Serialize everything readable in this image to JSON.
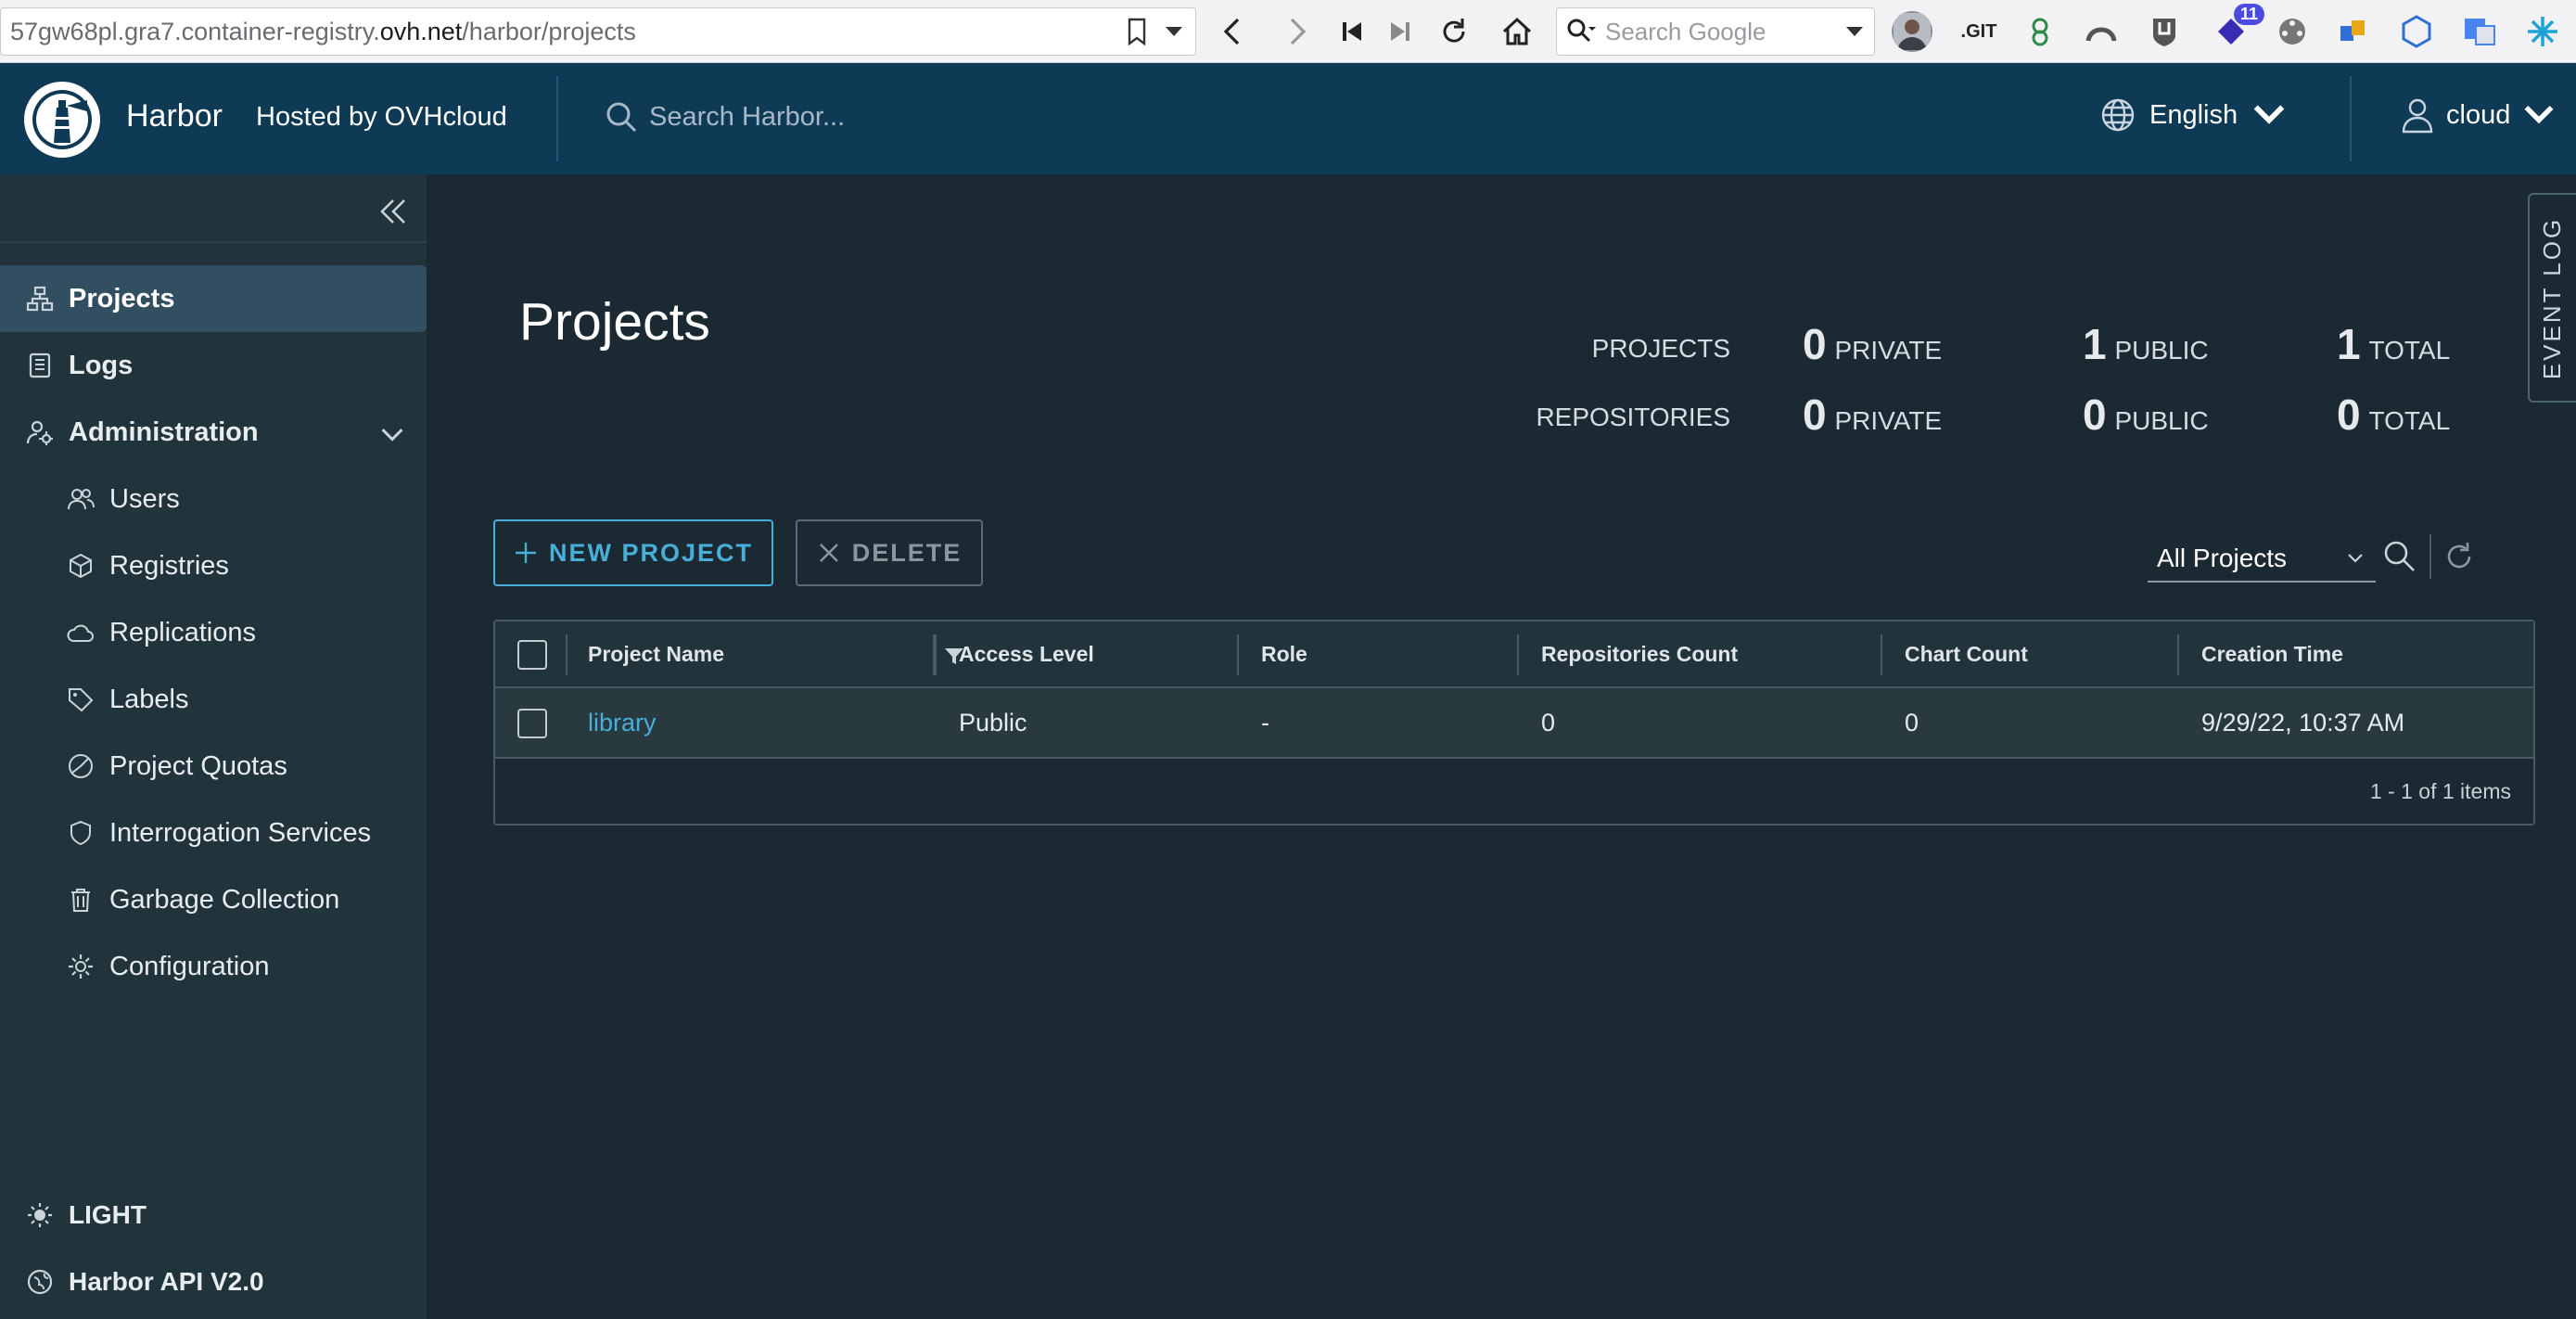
{
  "browser": {
    "url_prefix": "57gw68pl.gra7.container-registry.",
    "url_host": "ovh.net",
    "url_path": "/harbor/projects",
    "search_placeholder": "Search Google",
    "ext_git_label": ".GIT",
    "ext_badge_count": "11"
  },
  "header": {
    "brand": "Harbor",
    "hosted_by": "Hosted by OVHcloud",
    "search_placeholder": "Search Harbor...",
    "language": "English",
    "user": "cloud"
  },
  "sidebar": {
    "items": [
      {
        "label": "Projects",
        "icon": "projects-icon"
      },
      {
        "label": "Logs",
        "icon": "logs-icon"
      },
      {
        "label": "Administration",
        "icon": "administration-icon"
      }
    ],
    "admin_items": [
      {
        "label": "Users",
        "icon": "users-icon"
      },
      {
        "label": "Registries",
        "icon": "registries-icon"
      },
      {
        "label": "Replications",
        "icon": "replications-icon"
      },
      {
        "label": "Labels",
        "icon": "labels-icon"
      },
      {
        "label": "Project Quotas",
        "icon": "quotas-icon"
      },
      {
        "label": "Interrogation Services",
        "icon": "shield-icon"
      },
      {
        "label": "Garbage Collection",
        "icon": "trash-icon"
      },
      {
        "label": "Configuration",
        "icon": "gear-icon"
      }
    ],
    "theme_toggle": "LIGHT",
    "api_link": "Harbor API V2.0"
  },
  "main": {
    "title": "Projects",
    "event_log": "EVENT LOG",
    "summary": {
      "projects_label": "PROJECTS",
      "repositories_label": "REPOSITORIES",
      "private_unit": "PRIVATE",
      "public_unit": "PUBLIC",
      "total_unit": "TOTAL",
      "projects_private": "0",
      "projects_public": "1",
      "projects_total": "1",
      "repositories_private": "0",
      "repositories_public": "0",
      "repositories_total": "0"
    },
    "new_project_label": "NEW PROJECT",
    "delete_label": "DELETE",
    "filter_value": "All Projects",
    "table": {
      "columns": [
        "Project Name",
        "Access Level",
        "Role",
        "Repositories Count",
        "Chart Count",
        "Creation Time"
      ],
      "rows": [
        {
          "name": "library",
          "access": "Public",
          "role": "-",
          "repos": "0",
          "charts": "0",
          "created": "9/29/22, 10:37 AM"
        }
      ],
      "footer": "1 - 1 of 1 items"
    }
  },
  "colors": {
    "header_bg": "#0f3a56",
    "sidebar_bg": "#21333b",
    "main_bg": "#1b2a32",
    "accent": "#49afd9"
  }
}
